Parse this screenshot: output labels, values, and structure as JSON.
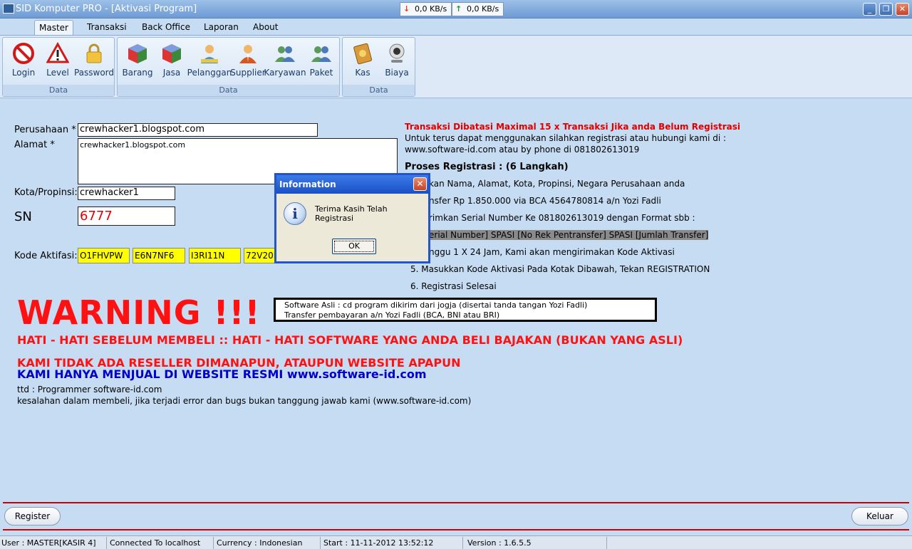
{
  "window": {
    "title": "SID Komputer PRO - [Aktivasi Program]",
    "net_down": "0,0 KB/s",
    "net_up": "0,0 KB/s",
    "minimize": "_",
    "restore": "❐",
    "close": "✕"
  },
  "tabs": [
    "Master",
    "Transaksi",
    "Back Office",
    "Laporan",
    "About"
  ],
  "ribbon": {
    "group1": {
      "label": "Data",
      "items": [
        "Login",
        "Level",
        "Password"
      ]
    },
    "group2": {
      "label": "Data",
      "items": [
        "Barang",
        "Jasa",
        "Pelanggan",
        "Supplier",
        "Karyawan",
        "Paket"
      ]
    },
    "group3": {
      "label": "Data",
      "items": [
        "Kas",
        "Biaya"
      ]
    }
  },
  "form": {
    "perusahaan_label": "Perusahaan *",
    "perusahaan_value": "crewhacker1.blogspot.com",
    "alamat_label": "Alamat *",
    "alamat_value": "crewhacker1.blogspot.com",
    "kota_label": "Kota/Propinsi:",
    "kota_value": "crewhacker1",
    "sn_label": "SN",
    "sn_value": "6777",
    "kode_label": "Kode Aktifasi:",
    "kode_values": [
      "O1FHVPW",
      "E6N7NF6",
      "I3RI11N",
      "72V20I"
    ]
  },
  "info": {
    "red_heading": "Transaksi Dibatasi Maximal 15 x Transaksi Jika anda Belum Registrasi",
    "line1": "Untuk terus dapat menggunakan silahkan registrasi atau hubungi kami di :",
    "line2": "www.software-id.com atau by phone di 081802613019",
    "proses_heading": "Proses Registrasi : (6 Langkah)",
    "step1": "kan Nama, Alamat, Kota, Propinsi, Negara Perusahaan anda",
    "step2": "nsfer Rp 1.850.000 via BCA 4564780814 a/n Yozi Fadli",
    "step3": "rimkan Serial Number Ke 081802613019 dengan Format sbb :",
    "step3_format": "erial Number] SPASI [No Rek Pentransfer] SPASI [Jumlah Transfer]",
    "step4": "nggu 1 X 24 Jam, Kami akan mengirimakan Kode Aktivasi",
    "step5": "5. Masukkan Kode Aktivasi Pada Kotak Dibawah, Tekan REGISTRATION",
    "step6": "6. Registrasi Selesai",
    "box_line1": "Software Asli : cd program dikirim dari jogja (disertai tanda tangan Yozi Fadli)",
    "box_line2": "Transfer pembayaran a/n Yozi Fadli (BCA, BNI atau BRI)"
  },
  "warning": {
    "title": "WARNING !!!",
    "line1": "HATI - HATI SEBELUM MEMBELI :: HATI - HATI SOFTWARE YANG ANDA BELI BAJAKAN (BUKAN YANG ASLI)",
    "line2": "KAMI TIDAK ADA RESELLER DIMANAPUN, ATAUPUN WEBSITE APAPUN",
    "line3": "KAMI HANYA MENJUAL DI WEBSITE RESMI www.software-id.com",
    "ttd": "ttd : Programmer software-id.com",
    "note": "kesalahan dalam membeli, jika terjadi error dan bugs bukan tanggung jawab kami (www.software-id.com)"
  },
  "buttons": {
    "register": "Register",
    "keluar": "Keluar"
  },
  "status": {
    "user": "User : MASTER[KASIR 4]",
    "connection": "Connected To localhost",
    "currency": "Currency : Indonesian",
    "start": "Start  : 11-11-2012 13:52:12",
    "version": "Version : 1.6.5.5"
  },
  "dialog": {
    "title": "Information",
    "message": "Terima Kasih Telah Registrasi",
    "ok": "OK",
    "close": "✕"
  },
  "colors": {
    "accent_red": "#ff1111",
    "accent_blue": "#0000cc",
    "kode_bg": "#ffff00",
    "bg": "#c6dcf2"
  }
}
